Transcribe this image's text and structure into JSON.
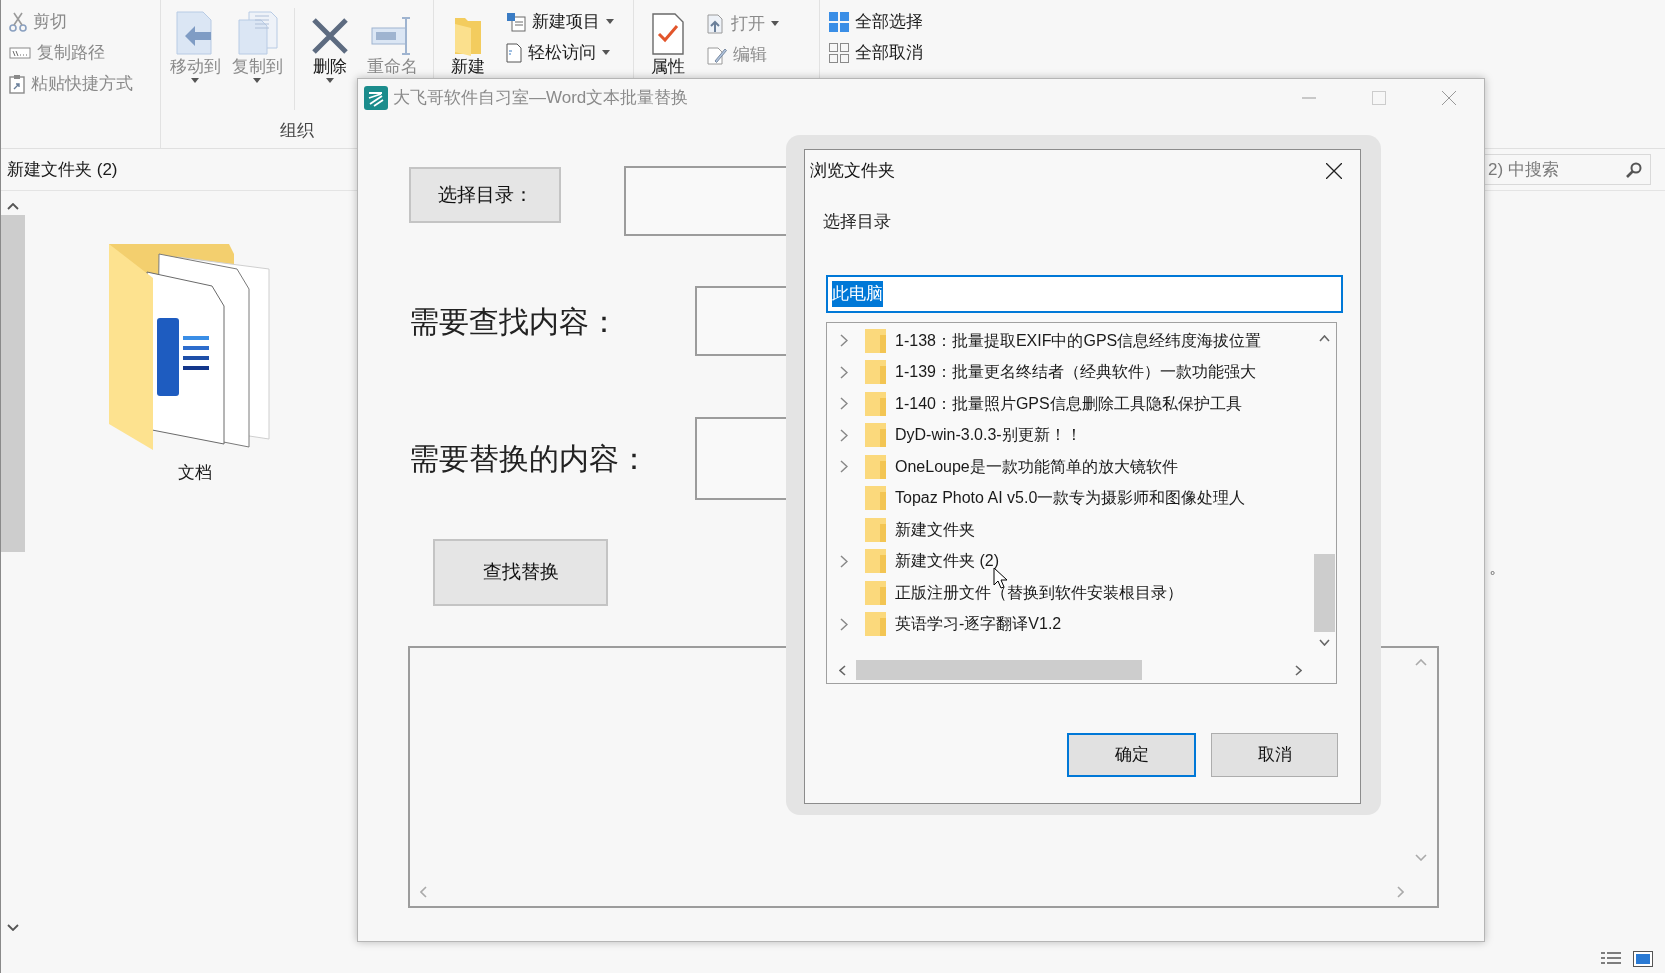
{
  "explorer": {
    "ribbon": {
      "clipboard": [
        {
          "label": "剪切",
          "disabled": true
        },
        {
          "label": "复制路径",
          "disabled": true
        },
        {
          "label": "粘贴快捷方式",
          "disabled": true
        }
      ],
      "organize": {
        "label": "组织",
        "commands": [
          {
            "label": "移动到",
            "disabled": true,
            "dropdown": true
          },
          {
            "label": "复制到",
            "disabled": true,
            "dropdown": true
          },
          {
            "label": "删除",
            "disabled": false,
            "dropdown": true
          },
          {
            "label": "重命名",
            "disabled": true,
            "dropdown": false
          }
        ]
      },
      "new": {
        "large": {
          "label": "新建",
          "disabled": false
        },
        "small": [
          {
            "label": "新建项目",
            "disabled": false,
            "dropdown": true
          },
          {
            "label": "轻松访问",
            "disabled": false,
            "dropdown": true
          }
        ]
      },
      "open": {
        "large": {
          "label": "属性",
          "disabled": false
        },
        "small": [
          {
            "label": "打开",
            "disabled": true,
            "dropdown": true
          },
          {
            "label": "编辑",
            "disabled": true,
            "dropdown": false
          }
        ]
      },
      "select": [
        {
          "label": "全部选择",
          "disabled": false
        },
        {
          "label": "全部取消",
          "disabled": false
        }
      ]
    },
    "path": "新建文件夹 (2)",
    "search_placeholder": "2) 中搜索",
    "items": [
      {
        "label": "文档"
      }
    ],
    "fragment": "。"
  },
  "app": {
    "title": "大飞哥软件自习室—Word文本批量替换",
    "choose_button": "选择目录：",
    "find_label": "需要查找内容：",
    "replace_label": "需要替换的内容：",
    "run_button": "查找替换"
  },
  "dialog": {
    "title": "浏览文件夹",
    "prompt": "选择目录",
    "path": "此电脑",
    "path_selected": true,
    "folders": [
      {
        "name": "1-138：批量提取EXIF中的GPS信息经纬度海拔位置",
        "expandable": true,
        "selected": false
      },
      {
        "name": "1-139：批量更名终结者（经典软件）一款功能强大",
        "expandable": true,
        "selected": false
      },
      {
        "name": "1-140：批量照片GPS信息删除工具隐私保护工具",
        "expandable": true,
        "selected": false
      },
      {
        "name": "DyD-win-3.0.3-别更新！！",
        "expandable": true,
        "selected": false
      },
      {
        "name": "OneLoupe是一款功能简单的放大镜软件",
        "expandable": true,
        "selected": false
      },
      {
        "name": "Topaz Photo AI v5.0一款专为摄影师和图像处理人",
        "expandable": false,
        "selected": false
      },
      {
        "name": "新建文件夹",
        "expandable": false,
        "selected": false
      },
      {
        "name": "新建文件夹 (2)",
        "expandable": true,
        "selected": false
      },
      {
        "name": "正版注册文件（替换到软件安装根目录）",
        "expandable": false,
        "selected": false
      },
      {
        "name": "英语学习-逐字翻译V1.2",
        "expandable": true,
        "selected": false
      }
    ],
    "ok": "确定",
    "cancel": "取消"
  }
}
